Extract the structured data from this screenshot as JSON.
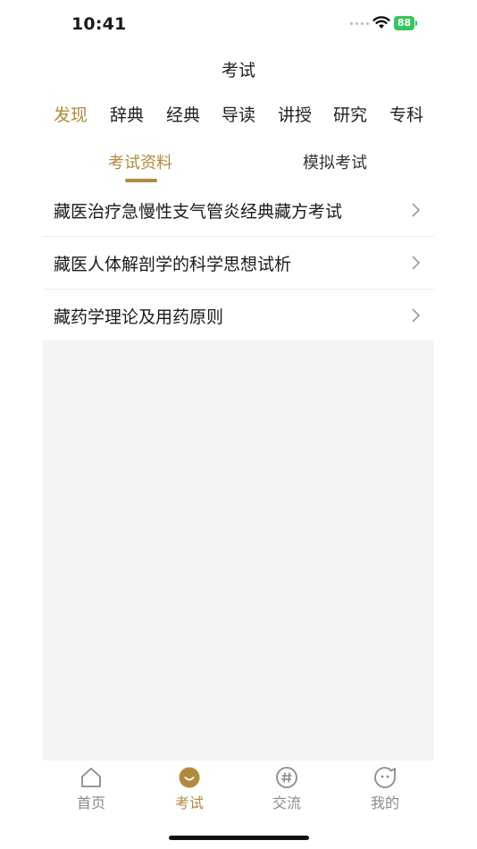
{
  "status_bar": {
    "time": "10:41",
    "battery": "88"
  },
  "nav": {
    "title": "考试"
  },
  "category_tabs": [
    {
      "label": "发现",
      "active": true
    },
    {
      "label": "辞典",
      "active": false
    },
    {
      "label": "经典",
      "active": false
    },
    {
      "label": "导读",
      "active": false
    },
    {
      "label": "讲授",
      "active": false
    },
    {
      "label": "研究",
      "active": false
    },
    {
      "label": "专科",
      "active": false
    }
  ],
  "sub_tabs": [
    {
      "label": "考试资料",
      "active": true
    },
    {
      "label": "模拟考试",
      "active": false
    }
  ],
  "list": [
    {
      "label": "藏医治疗急慢性支气管炎经典藏方考试"
    },
    {
      "label": "藏医人体解剖学的科学思想试析"
    },
    {
      "label": "藏药学理论及用药原则"
    }
  ],
  "tab_bar": [
    {
      "label": "首页",
      "icon": "home-icon",
      "active": false
    },
    {
      "label": "考试",
      "icon": "exam-smile-icon",
      "active": true
    },
    {
      "label": "交流",
      "icon": "hashtag-icon",
      "active": false
    },
    {
      "label": "我的",
      "icon": "profile-face-icon",
      "active": false
    }
  ],
  "colors": {
    "accent": "#b18a3c",
    "battery": "#34c759",
    "empty_bg": "#f4f4f4"
  }
}
